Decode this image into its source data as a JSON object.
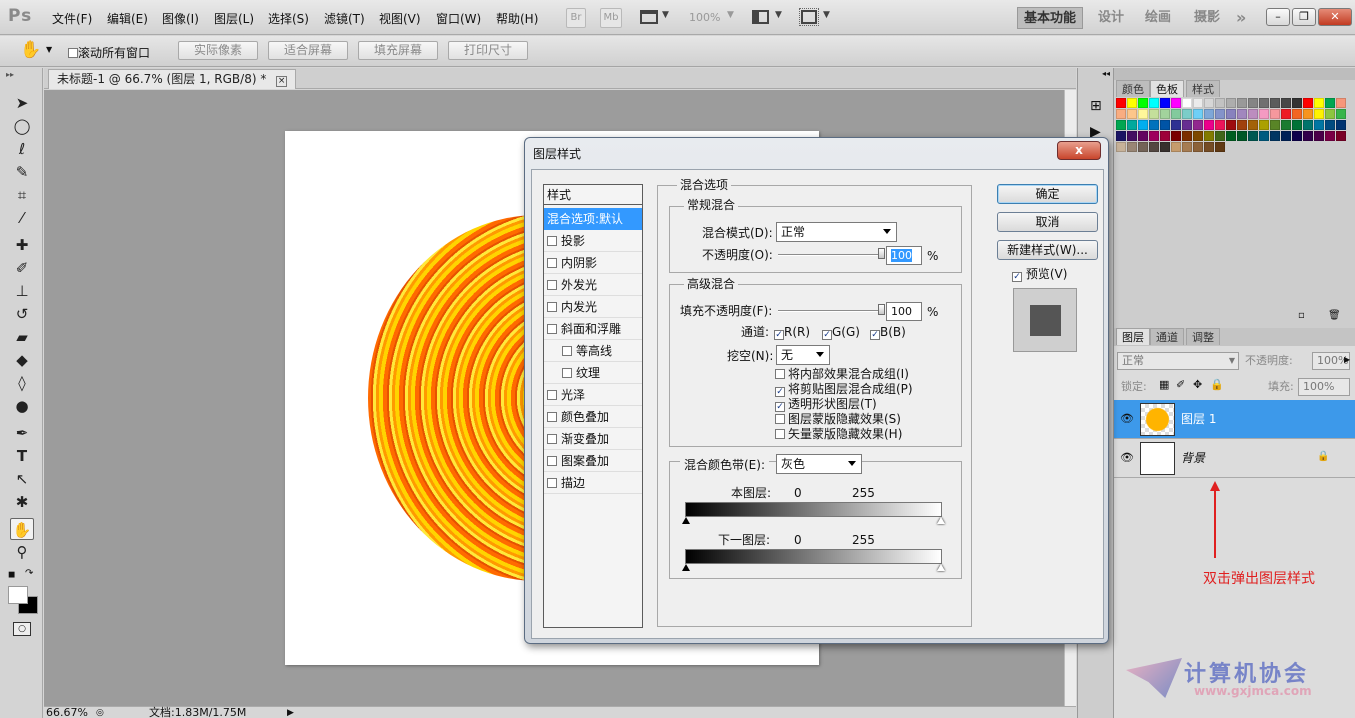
{
  "app": {
    "logo": "Ps"
  },
  "menus": [
    "文件(F)",
    "编辑(E)",
    "图像(I)",
    "图层(L)",
    "选择(S)",
    "滤镜(T)",
    "视图(V)",
    "窗口(W)",
    "帮助(H)"
  ],
  "appbar": {
    "br": "Br",
    "mb": "Mb",
    "zoom": "100%"
  },
  "workspaces": {
    "active": "基本功能",
    "items": [
      "设计",
      "绘画",
      "摄影"
    ],
    "more": "»"
  },
  "options": {
    "scroll_all": "滚动所有窗口",
    "buttons": [
      "实际像素",
      "适合屏幕",
      "填充屏幕",
      "打印尺寸"
    ]
  },
  "document": {
    "tab_title": "未标题-1 @ 66.7% (图层 1, RGB/8) *",
    "close": "×"
  },
  "status": {
    "zoom": "66.67%",
    "doc": "文档:1.83M/1.75M"
  },
  "panels": {
    "color_tabs": [
      "颜色",
      "色板",
      "样式"
    ],
    "swatches": [
      "#ff0000",
      "#ffff00",
      "#00ff00",
      "#00ffff",
      "#0000ff",
      "#ff00ff",
      "#ffffff",
      "#ebebeb",
      "#d6d6d6",
      "#c2c2c2",
      "#adadad",
      "#999999",
      "#858585",
      "#707070",
      "#5c5c5c",
      "#474747",
      "#333333",
      "#ff0000",
      "#ffff00",
      "#00a651",
      "#f7977a",
      "#f9ad81",
      "#fdc68a",
      "#fff79a",
      "#c4df9b",
      "#a2d39c",
      "#82ca9d",
      "#7bcdc8",
      "#6ecff6",
      "#7ea7d8",
      "#8493ca",
      "#8882be",
      "#a187be",
      "#bc8dbf",
      "#f49ac2",
      "#f6989d",
      "#ed1c24",
      "#f26522",
      "#f7941d",
      "#fff200",
      "#8dc63f",
      "#39b54a",
      "#00a651",
      "#00a99d",
      "#00aeef",
      "#0072bc",
      "#0054a6",
      "#2e3192",
      "#662d91",
      "#92278f",
      "#ec008c",
      "#ed145b",
      "#9e0b0f",
      "#a0410d",
      "#a36209",
      "#aba000",
      "#598527",
      "#1a7b30",
      "#007236",
      "#00746b",
      "#0076a3",
      "#004b80",
      "#003471",
      "#1b1464",
      "#440e62",
      "#630460",
      "#9e005d",
      "#9e0039",
      "#790000",
      "#7b2e00",
      "#7d4900",
      "#827b00",
      "#406618",
      "#005e20",
      "#005826",
      "#005952",
      "#005b7f",
      "#003663",
      "#002157",
      "#0d004c",
      "#32004b",
      "#4b0049",
      "#7b0046",
      "#7a0026",
      "#c7b299",
      "#998675",
      "#736357",
      "#534741",
      "#37302d",
      "#c69c6d",
      "#a67c52",
      "#8c6239",
      "#754c24",
      "#603913"
    ],
    "layer_tabs": [
      "图层",
      "通道",
      "调整"
    ],
    "blend_mode": "正常",
    "opacity_label": "不透明度:",
    "opacity_value": "100%",
    "lock_label": "锁定:",
    "fill_label": "填充:",
    "fill_value": "100%",
    "layers": [
      {
        "name": "图层 1",
        "selected": true
      },
      {
        "name": "背景",
        "selected": false,
        "locked": true
      }
    ],
    "annotation": "双击弹出图层样式"
  },
  "watermark": {
    "cn": "计算机协会",
    "url": "www.gxjmca.com"
  },
  "dialog": {
    "title": "图层样式",
    "close": "x",
    "styles_header": "样式",
    "styles": [
      {
        "label": "混合选项:默认",
        "checkbox": false,
        "selected": true,
        "indent": false
      },
      {
        "label": "投影",
        "checkbox": true,
        "indent": false
      },
      {
        "label": "内阴影",
        "checkbox": true,
        "indent": false
      },
      {
        "label": "外发光",
        "checkbox": true,
        "indent": false
      },
      {
        "label": "内发光",
        "checkbox": true,
        "indent": false
      },
      {
        "label": "斜面和浮雕",
        "checkbox": true,
        "indent": false
      },
      {
        "label": "等高线",
        "checkbox": true,
        "indent": true
      },
      {
        "label": "纹理",
        "checkbox": true,
        "indent": true
      },
      {
        "label": "光泽",
        "checkbox": true,
        "indent": false
      },
      {
        "label": "颜色叠加",
        "checkbox": true,
        "indent": false
      },
      {
        "label": "渐变叠加",
        "checkbox": true,
        "indent": false
      },
      {
        "label": "图案叠加",
        "checkbox": true,
        "indent": false
      },
      {
        "label": "描边",
        "checkbox": true,
        "indent": false
      }
    ],
    "blending_options": "混合选项",
    "general": {
      "title": "常规混合",
      "mode_label": "混合模式(D):",
      "mode_value": "正常",
      "opacity_label": "不透明度(O):",
      "opacity_value": "100",
      "percent": "%",
      "opacity": 1.0
    },
    "advanced": {
      "title": "高级混合",
      "fill_label": "填充不透明度(F):",
      "fill_value": "100",
      "fill": 1.0,
      "channels_label": "通道:",
      "channels": [
        "R(R)",
        "G(G)",
        "B(B)"
      ],
      "knockout_label": "挖空(N):",
      "knockout_value": "无",
      "options": [
        {
          "label": "将内部效果混合成组(I)",
          "checked": false
        },
        {
          "label": "将剪贴图层混合成组(P)",
          "checked": true
        },
        {
          "label": "透明形状图层(T)",
          "checked": true
        },
        {
          "label": "图层蒙版隐藏效果(S)",
          "checked": false
        },
        {
          "label": "矢量蒙版隐藏效果(H)",
          "checked": false
        }
      ]
    },
    "blend_if": {
      "label": "混合颜色带(E):",
      "value": "灰色",
      "this_layer": "本图层:",
      "underlying": "下一图层:",
      "min": "0",
      "max": "255"
    },
    "buttons": {
      "ok": "确定",
      "cancel": "取消",
      "new_style": "新建样式(W)...",
      "preview": "预览(V)"
    },
    "check": "✓"
  }
}
